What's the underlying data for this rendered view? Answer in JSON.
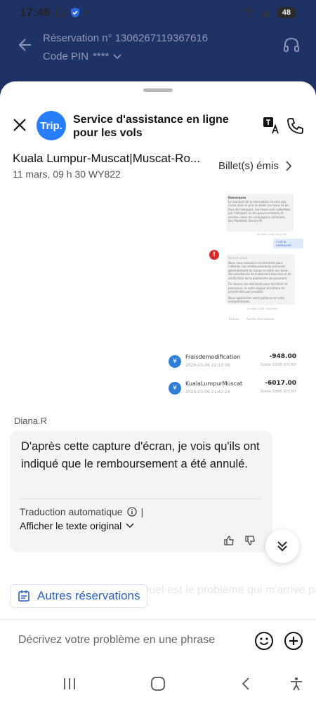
{
  "status_bar": {
    "time": "17:46",
    "battery": "48"
  },
  "top_header": {
    "reservation": "Réservation n° 1306267119367616",
    "pin_label": "Code PIN",
    "pin_mask": "****"
  },
  "chat_header": {
    "logo_text": "Trip.",
    "title": "Service d'assistance en ligne pour les vols"
  },
  "booking": {
    "route": "Kuala Lumpur-Muscat|Muscat-Ro...",
    "flight_info": "11 mars, 09 h 30 WY822",
    "ticket_status": "Billet(s) émis"
  },
  "screenshot1": {
    "box_a_title": "Remarques",
    "box_a_text": "Le montant de la réservation ne sera pas inclus dans le prix du billet, les taxes et les frais de l'aéroport. Les taxes sont collectées par l'aéroport ou les gouvernements et versées selon les compagnies aériennes.",
    "box_a_note": "Ses Modalités Service N",
    "ts1": "09 mars 2026, 18:14:09",
    "chip": "c'est la remboursé",
    "box_b_name": "Service client",
    "box_b_p1": "Nous nous excusons sincèrement pour l'attente. Les remboursements prennent généralement du temps à traiter en raison des procédures de traitement bancaire et de vérification de la plateforme de paiement.",
    "box_b_p2": "Ce nouvel une demande pour accélérer le processus, et notre équipe le traitera en priorité dès que possible.",
    "box_b_p3": "Nous apprécions votre patience et votre compréhension.",
    "ts2": "09 mars 2026, 18:16:09",
    "fb1": "Évaluer",
    "fb2": "Autres réservations"
  },
  "screenshot2": {
    "rows": [
      {
        "name": "Fraisdemodification",
        "date": "2026-03-06 22:13:09",
        "amount": "-948.00",
        "balance": "Solde 5038.97CNY"
      },
      {
        "name": "KualaLumpurMuscat",
        "date": "2026-03-06 21:42:14",
        "amount": "-6017.00",
        "balance": "Solde 5986.97CNY"
      }
    ]
  },
  "message": {
    "sender": "Diana.R",
    "text": "D'après cette capture d'écran, je vois qu'ils ont indiqué que le remboursement a été annulé.",
    "auto_translation": "Traduction automatique",
    "separator": "|",
    "show_original": "Afficher le texte original"
  },
  "ghost_text": "Quel est le problème qui m'arrive pas",
  "other_reservations": "Autres réservations",
  "input": {
    "placeholder": "Décrivez votre problème en une phrase"
  },
  "colors": {
    "brand": "#287dfa",
    "header_bg": "#1e3266",
    "link": "#2b62c9"
  }
}
